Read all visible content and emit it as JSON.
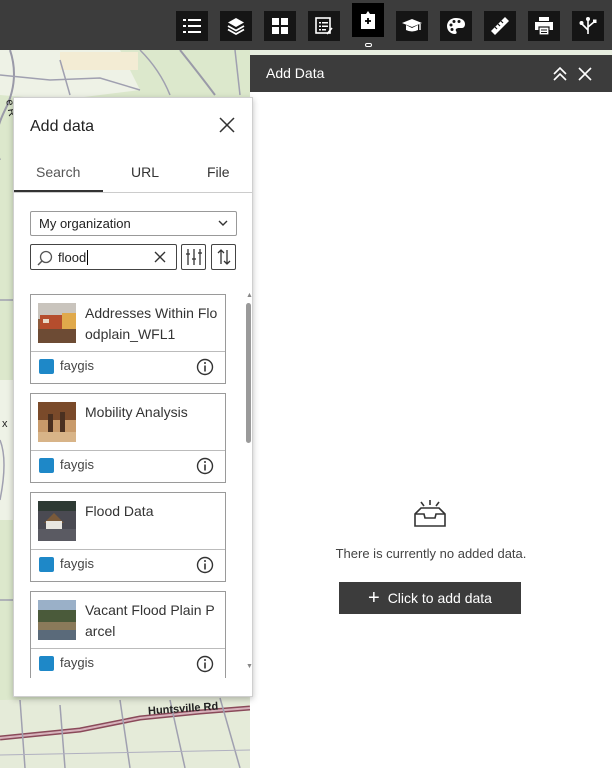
{
  "toolbar": {
    "tools": [
      {
        "name": "layer-list-icon"
      },
      {
        "name": "layers-icon"
      },
      {
        "name": "basemap-gallery-icon"
      },
      {
        "name": "legend-icon"
      },
      {
        "name": "add-data-icon",
        "active": true
      },
      {
        "name": "education-icon"
      },
      {
        "name": "theme-palette-icon"
      },
      {
        "name": "measure-ruler-icon"
      },
      {
        "name": "print-icon"
      },
      {
        "name": "share-icon"
      }
    ]
  },
  "map": {
    "road_label": "Huntsville Rd",
    "side_label": "x",
    "side_label_top": "e R"
  },
  "panel": {
    "title": "Add Data",
    "empty_text": "There is currently no added data.",
    "add_button": "Click to add data"
  },
  "popup": {
    "title": "Add data",
    "tabs": [
      "Search",
      "URL",
      "File"
    ],
    "scope_select": "My organization",
    "search_value": "flood",
    "results": [
      {
        "title": "Addresses Within Floodplain_WFL1",
        "owner": "faygis",
        "thumb": "floodplain-photo"
      },
      {
        "title": "Mobility Analysis",
        "owner": "faygis",
        "thumb": "mobility-photo"
      },
      {
        "title": "Flood Data",
        "owner": "faygis",
        "thumb": "flood-house-photo"
      },
      {
        "title": "Vacant Flood Plain Parcel",
        "owner": "faygis",
        "thumb": "river-photo"
      }
    ]
  },
  "colors": {
    "toolbar_bg": "#3c3c3c",
    "button_bg": "#151515",
    "accent_blue": "#1e88c8"
  }
}
